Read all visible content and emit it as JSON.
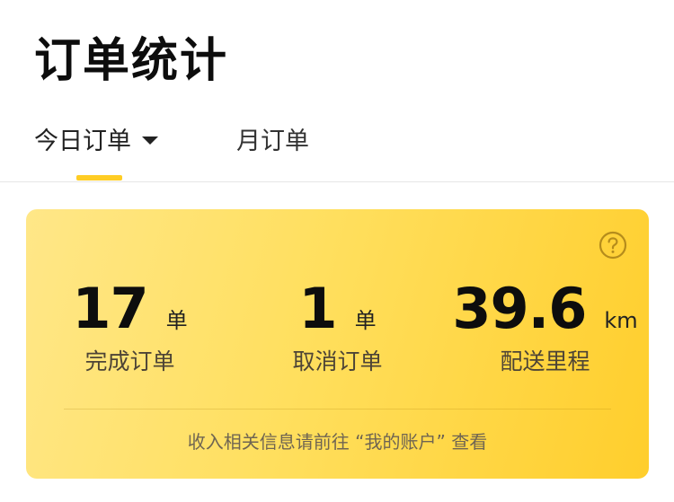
{
  "header": {
    "title": "订单统计"
  },
  "tabs": [
    {
      "label": "今日订单",
      "active": true,
      "has_dropdown": true
    },
    {
      "label": "月订单",
      "active": false
    }
  ],
  "summary": {
    "stats": [
      {
        "value": "17",
        "unit": "单",
        "label": "完成订单"
      },
      {
        "value": "1",
        "unit": "单",
        "label": "取消订单"
      },
      {
        "value": "39.6",
        "unit": "km",
        "label": "配送里程"
      }
    ],
    "note": "收入相关信息请前往 “我的账户” 查看",
    "help_icon": "question-circle-icon"
  },
  "colors": {
    "accent": "#ffcd24",
    "card_gradient_start": "#ffe788",
    "card_gradient_end": "#ffce2c"
  }
}
